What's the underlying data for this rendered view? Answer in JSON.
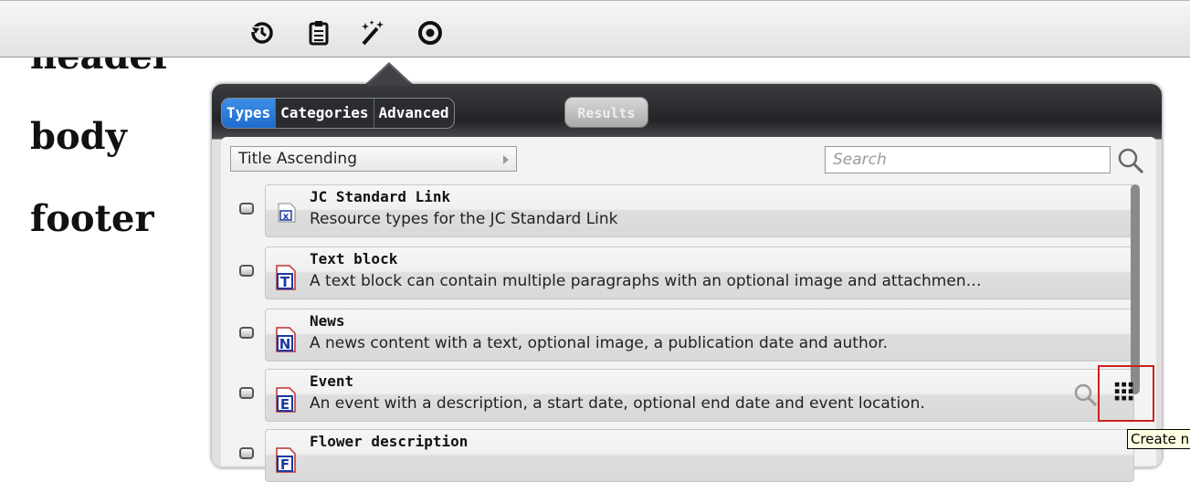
{
  "page": {
    "words": [
      "header",
      "body",
      "footer"
    ]
  },
  "toolbar": {
    "icons": [
      "history-icon",
      "clipboard-icon",
      "magic-wand-icon",
      "target-icon"
    ]
  },
  "popup": {
    "tabs": [
      {
        "label": "Types",
        "active": true
      },
      {
        "label": "Categories",
        "active": false
      },
      {
        "label": "Advanced",
        "active": false
      }
    ],
    "results_label": "Results",
    "sort": {
      "value": "Title Ascending"
    },
    "search": {
      "placeholder": "Search"
    },
    "items": [
      {
        "title": "JC Standard Link",
        "description": "Resource types for the JC Standard Link",
        "icon": "link-icon",
        "icon_letter": "x"
      },
      {
        "title": "Text block",
        "description": "A text block can contain multiple paragraphs with an optional image and attachmen…",
        "icon": "text-block-icon",
        "icon_letter": "T"
      },
      {
        "title": "News",
        "description": "A news content with a text, optional image, a publication date and author.",
        "icon": "news-icon",
        "icon_letter": "N"
      },
      {
        "title": "Event",
        "description": "An event with a description, a start date, optional end date and event location.",
        "icon": "event-icon",
        "icon_letter": "E"
      },
      {
        "title": "Flower description",
        "description": "",
        "icon": "flower-icon",
        "icon_letter": "F"
      }
    ],
    "tooltip": "Create n"
  },
  "colors": {
    "active_tab": "#1e6ccc",
    "highlight_border": "#d02020"
  }
}
